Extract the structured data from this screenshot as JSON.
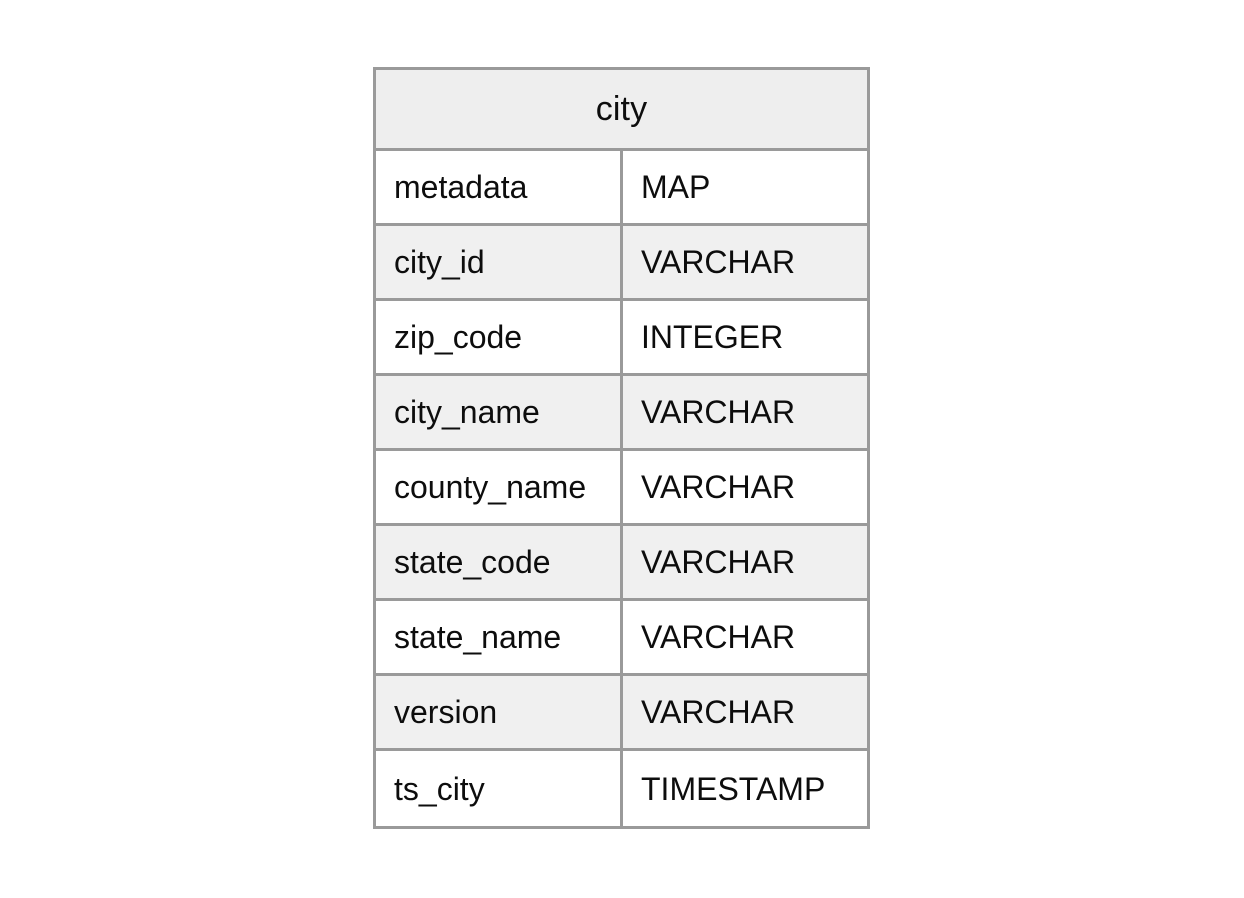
{
  "diagram": {
    "kind": "entity-relationship-table",
    "background_color": "#ffffff",
    "colors": {
      "border": "#9a9a9a",
      "header_fill": "#eeeeee",
      "row_fill": "#ffffff",
      "row_fill_striped": "#f0f0f0",
      "text": "#0d0d0d"
    }
  },
  "entity": {
    "title": "city",
    "columns": {
      "name_header": "",
      "type_header": ""
    },
    "fields": [
      {
        "name": "metadata",
        "type": "MAP"
      },
      {
        "name": "city_id",
        "type": "VARCHAR"
      },
      {
        "name": "zip_code",
        "type": "INTEGER"
      },
      {
        "name": "city_name",
        "type": "VARCHAR"
      },
      {
        "name": "county_name",
        "type": "VARCHAR"
      },
      {
        "name": "state_code",
        "type": "VARCHAR"
      },
      {
        "name": "state_name",
        "type": "VARCHAR"
      },
      {
        "name": "version",
        "type": "VARCHAR"
      },
      {
        "name": "ts_city",
        "type": "TIMESTAMP"
      }
    ]
  }
}
